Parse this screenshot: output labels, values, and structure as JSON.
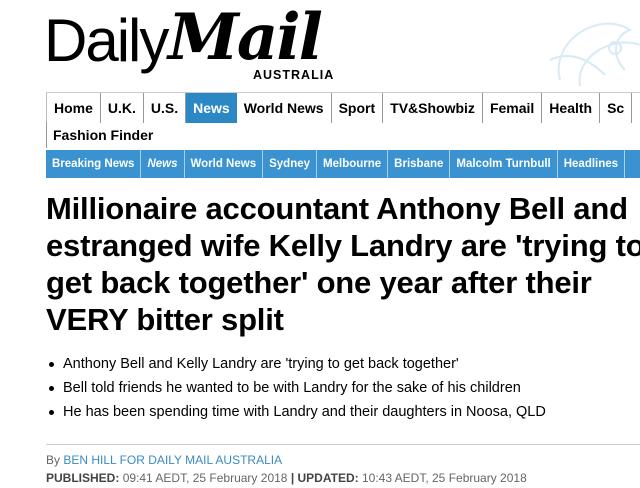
{
  "logo": {
    "daily": "Daily",
    "mail": "Mail",
    "sub": "AUSTRALIA"
  },
  "nav_primary": [
    "Home",
    "U.K.",
    "U.S.",
    "News",
    "World News",
    "Sport",
    "TV&Showbiz",
    "Femail",
    "Health",
    "Sc"
  ],
  "nav_primary_active": "News",
  "nav_primary_row2": [
    "Fashion Finder"
  ],
  "nav_secondary": [
    "Breaking News",
    "News",
    "World News",
    "Sydney",
    "Melbourne",
    "Brisbane",
    "Malcolm Turnbull",
    "Headlines"
  ],
  "colors": {
    "accent": "#2b88c5",
    "subnav": "#3a93d0",
    "author_link": "#3a8bc4"
  },
  "article": {
    "headline": "Millionaire accountant Anthony Bell and estranged wife Kelly Landry are 'trying to get back together' one year after their VERY bitter split",
    "bullets": [
      "Anthony Bell and Kelly Landry are 'trying to get back together'",
      "Bell told friends he wanted to be with Landry for the sake of his children",
      "He has been spending time with Landry and their daughters in Noosa, QLD"
    ],
    "byline_prefix": "By",
    "author": "BEN HILL FOR DAILY MAIL AUSTRALIA",
    "published_label": "PUBLISHED:",
    "published_value": "09:41 AEDT, 25 February 2018",
    "separator": "|",
    "updated_label": "UPDATED:",
    "updated_value": "10:43 AEDT, 25 February 2018"
  }
}
